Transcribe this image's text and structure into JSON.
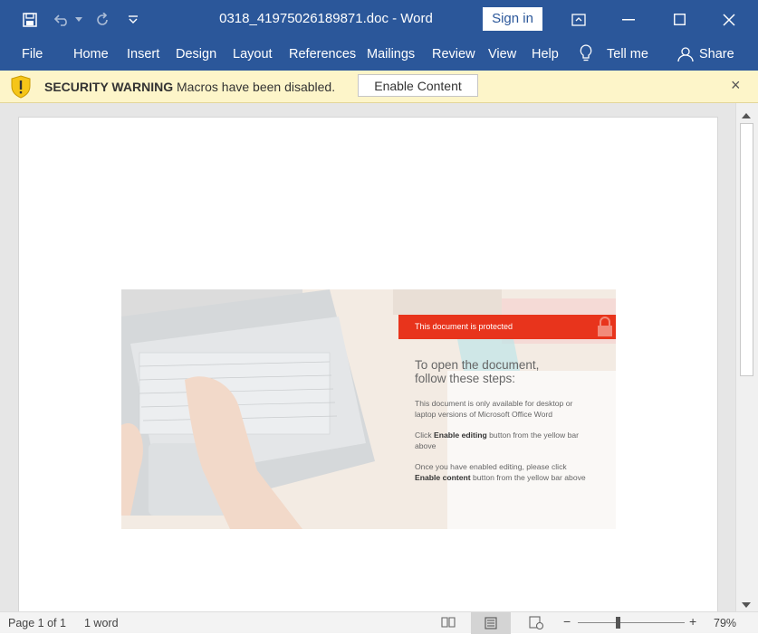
{
  "window": {
    "title": "0318_41975026189871.doc - Word",
    "sign_in": "Sign in"
  },
  "ribbon": {
    "tabs": [
      "File",
      "Home",
      "Insert",
      "Design",
      "Layout",
      "References",
      "Mailings",
      "Review",
      "View",
      "Help"
    ],
    "tell_me": "Tell me",
    "share": "Share"
  },
  "security_bar": {
    "title": "SECURITY WARNING",
    "message": "Macros have been disabled.",
    "button": "Enable Content",
    "color": "#fdf5c9"
  },
  "document_image": {
    "banner": "This document is protected",
    "heading_line1": "To open the document,",
    "heading_line2": "follow these steps:",
    "para1": "This document is only available for desktop or laptop versions of Microsoft Office Word",
    "para2_pre": "Click ",
    "para2_bold": "Enable editing",
    "para2_post": " button from the yellow bar above",
    "para3_pre": "Once you have enabled editing, please click ",
    "para3_bold": "Enable content",
    "para3_post": " button from the yellow bar above",
    "banner_color": "#e8341c"
  },
  "status": {
    "page": "Page 1 of 1",
    "words": "1 word",
    "zoom": "79%"
  },
  "colors": {
    "accent": "#2b579a"
  }
}
